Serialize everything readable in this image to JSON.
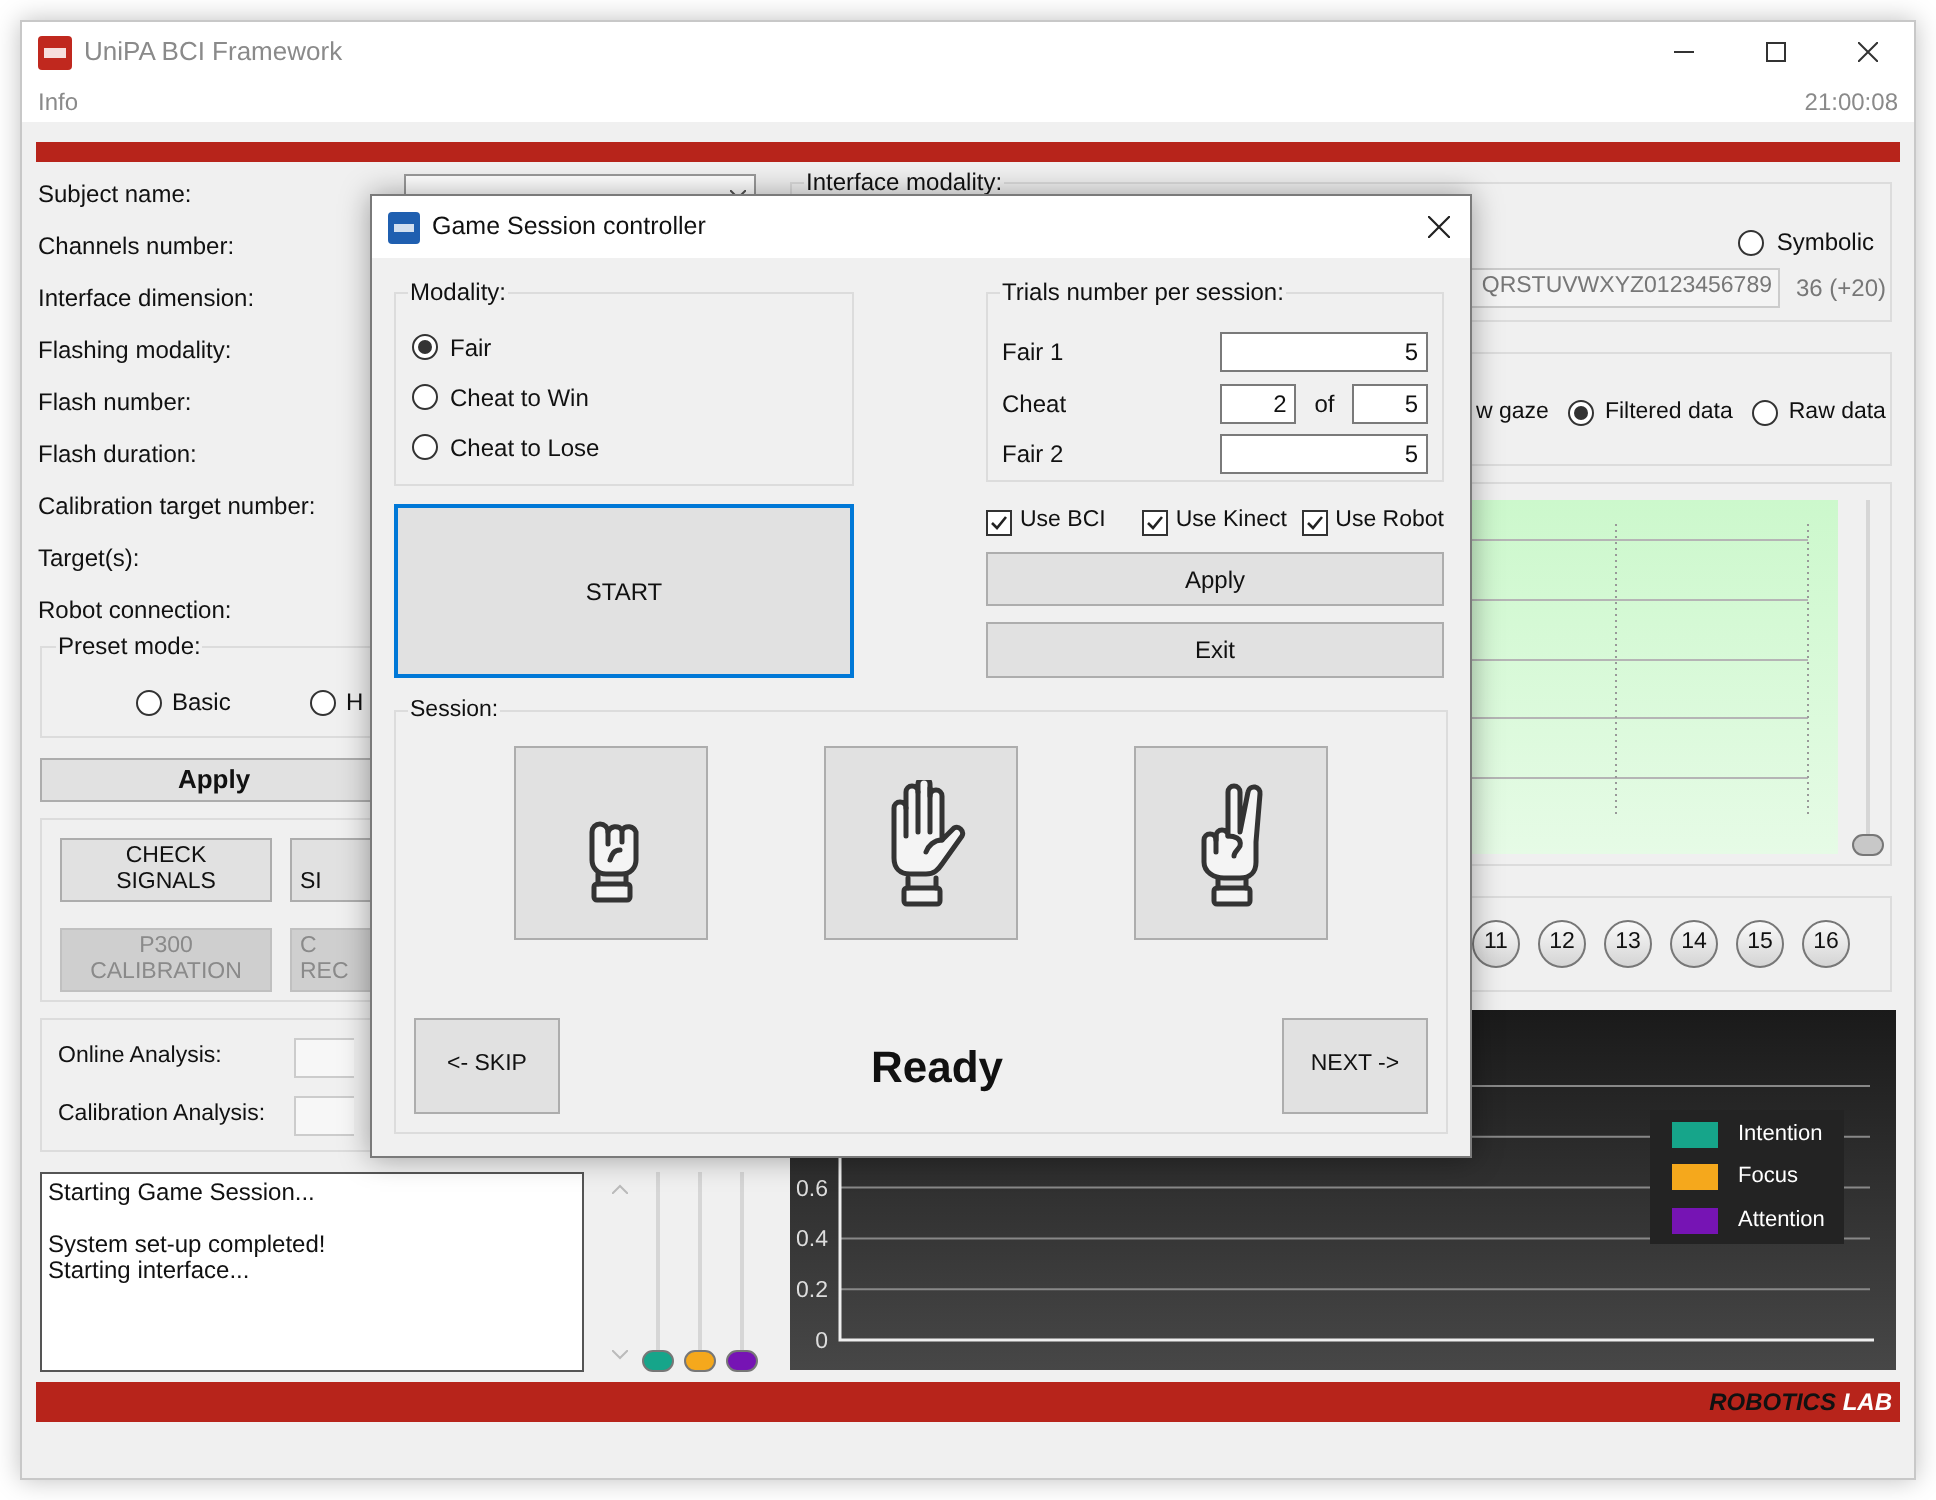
{
  "window": {
    "title": "UniPA BCI Framework"
  },
  "menu": [
    "Info"
  ],
  "clock": "21:00:08",
  "settings": {
    "labels": [
      "Subject name:",
      "Channels number:",
      "Interface dimension:",
      "Flashing modality:",
      "Flash number:",
      "Flash duration:",
      "Calibration target number:",
      "Target(s):",
      "Robot connection:"
    ]
  },
  "preset_mode": {
    "title": "Preset mode:",
    "options": [
      {
        "label": "Basic",
        "selected": false
      },
      {
        "label": "H",
        "selected": false
      }
    ]
  },
  "apply_button": "Apply",
  "action_buttons": [
    {
      "label": "CHECK\nSIGNALS",
      "disabled": false
    },
    {
      "label": "\nSI",
      "disabled": false
    },
    {
      "label": "P300\nCALIBRATION",
      "disabled": true
    },
    {
      "label": "C\nREC",
      "disabled": true
    }
  ],
  "analysis": [
    {
      "label": "Online Analysis:"
    },
    {
      "label": "Calibration Analysis:"
    }
  ],
  "log": "Starting Game Session...\n\nSystem set-up completed!\nStarting interface...",
  "mixer_sliders": [
    {
      "color": "#16a58a",
      "level": 0
    },
    {
      "color": "#f5a81c",
      "level": 0
    },
    {
      "color": "#7614b4",
      "level": 0
    }
  ],
  "interface_modality": {
    "title": "Interface modality:",
    "options": [
      {
        "label": "Symbolic",
        "selected": false
      }
    ],
    "characters": "QRSTUVWXYZ0123456789",
    "count": "36 (+20)"
  },
  "data_source": [
    {
      "label": "w gaze"
    },
    {
      "label": "Filtered data",
      "selected": true
    },
    {
      "label": "Raw data",
      "selected": false
    }
  ],
  "signal_plot": {
    "level": 0
  },
  "channels": [
    "11",
    "12",
    "13",
    "14",
    "15",
    "16"
  ],
  "performance": {
    "chart_data": {
      "type": "line",
      "grid": true,
      "ylim": [
        0,
        1
      ],
      "yticks": [
        0,
        0.2,
        0.4,
        0.6
      ],
      "series": [
        {
          "name": "Intention",
          "color": "#16a58a"
        },
        {
          "name": "Focus",
          "color": "#f5a81c"
        },
        {
          "name": "Attention",
          "color": "#7614b4"
        }
      ]
    }
  },
  "footer": {
    "brand": "ROBOTICS",
    "brand_suffix": "LAB"
  },
  "dialog": {
    "title": "Game Session controller",
    "modality": {
      "title": "Modality:",
      "options": [
        {
          "label": "Fair",
          "selected": true
        },
        {
          "label": "Cheat to Win",
          "selected": false
        },
        {
          "label": "Cheat to Lose",
          "selected": false
        }
      ]
    },
    "start_button": "START",
    "trials": {
      "title": "Trials number per session:",
      "rows": [
        {
          "kind": "single",
          "label": "Fair 1",
          "value": "5"
        },
        {
          "kind": "range",
          "label": "Cheat",
          "value": "2",
          "separator": "of",
          "total": "5"
        },
        {
          "kind": "single",
          "label": "Fair 2",
          "value": "5"
        }
      ]
    },
    "options": [
      {
        "label": "Use BCI",
        "checked": true
      },
      {
        "label": "Use Kinect",
        "checked": true
      },
      {
        "label": "Use Robot",
        "checked": true
      }
    ],
    "apply_button": "Apply",
    "exit_button": "Exit",
    "session": {
      "title": "Session:",
      "gestures": [
        {
          "kind": "rock"
        },
        {
          "kind": "paper"
        },
        {
          "kind": "scissors"
        }
      ],
      "skip_button": "<- SKIP",
      "status": "Ready",
      "next_button": "NEXT ->"
    }
  }
}
